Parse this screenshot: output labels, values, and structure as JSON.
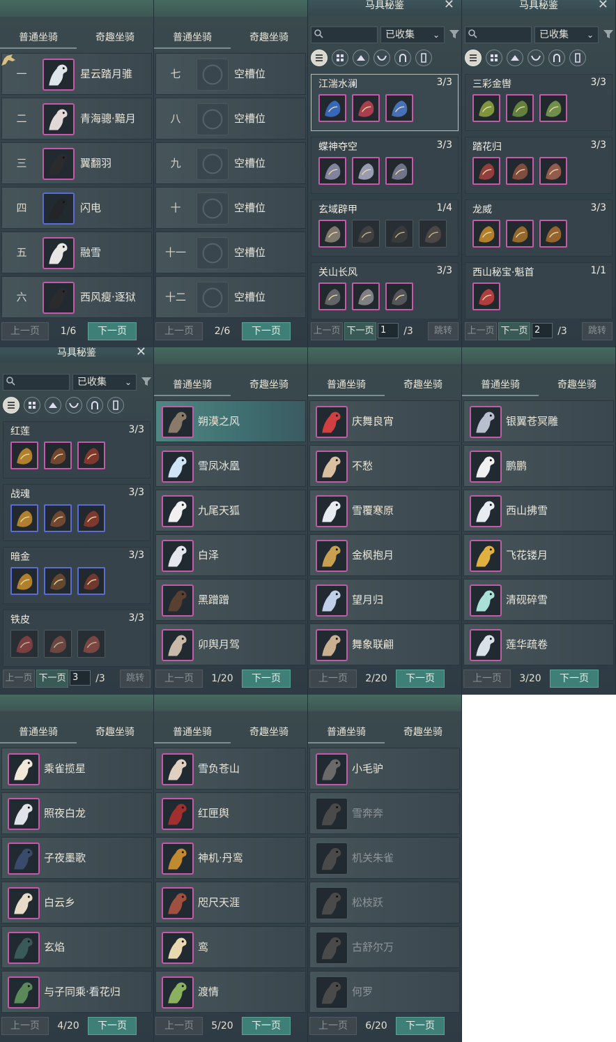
{
  "tab_labels": {
    "normal": "普通坐骑",
    "special": "奇趣坐骑"
  },
  "pager_labels": {
    "prev": "上一页",
    "next": "下一页",
    "jump": "跳转"
  },
  "codex": {
    "title": "马具秘鉴",
    "filter_value": "已收集",
    "search_placeholder": "",
    "close_glyph": "✕",
    "filter_chevron": "⌄"
  },
  "panels": [
    {
      "id": "slots-1",
      "page": "1/6",
      "rows": [
        {
          "num": "一",
          "name": "星云踏月骓",
          "frame": "pink",
          "color": "#dfe6ea"
        },
        {
          "num": "二",
          "name": "青海骢·黯月",
          "frame": "pink",
          "color": "#e2d8d6"
        },
        {
          "num": "三",
          "name": "翼翻羽",
          "frame": "pink",
          "color": "#2b2b2e"
        },
        {
          "num": "四",
          "name": "闪电",
          "frame": "blue",
          "color": "#242528"
        },
        {
          "num": "五",
          "name": "融雪",
          "frame": "pink",
          "color": "#e9e6e6"
        },
        {
          "num": "六",
          "name": "西风瘦·逐狱",
          "frame": "pink",
          "color": "#2b2b2e"
        }
      ]
    },
    {
      "id": "slots-2",
      "page": "2/6",
      "rows": [
        {
          "num": "七",
          "name": "空槽位",
          "frame": "none"
        },
        {
          "num": "八",
          "name": "空槽位",
          "frame": "none"
        },
        {
          "num": "九",
          "name": "空槽位",
          "frame": "none"
        },
        {
          "num": "十",
          "name": "空槽位",
          "frame": "none"
        },
        {
          "num": "十一",
          "name": "空槽位",
          "frame": "none"
        },
        {
          "num": "十二",
          "name": "空槽位",
          "frame": "none"
        }
      ]
    },
    {
      "id": "codex-1",
      "page_input": "1",
      "page_total": "/3",
      "sets": [
        {
          "name": "江湍水澜",
          "count": "3/3",
          "pieces": [
            "pink",
            "pink",
            "pink"
          ],
          "colors": [
            "#3a6ec8",
            "#b84050",
            "#4a78c8"
          ]
        },
        {
          "name": "蝶神夺空",
          "count": "3/3",
          "pieces": [
            "pink",
            "pink",
            "pink"
          ],
          "colors": [
            "#8c8ea8",
            "#a6a8c0",
            "#7a7c94"
          ]
        },
        {
          "name": "玄域辟甲",
          "count": "1/4",
          "pieces": [
            "pink",
            "dark",
            "dark",
            "dark"
          ],
          "colors": [
            "#8a8274",
            "#4a4440",
            "#3e3a36",
            "#5a4a46"
          ]
        },
        {
          "name": "关山长风",
          "count": "3/3",
          "pieces": [
            "pink",
            "pink",
            "pink"
          ],
          "colors": [
            "#6a6a6e",
            "#8a8a8e",
            "#5a5a5e"
          ]
        }
      ]
    },
    {
      "id": "codex-2",
      "page_input": "2",
      "page_total": "/3",
      "sets": [
        {
          "name": "三彩金辔",
          "count": "3/3",
          "pieces": [
            "pink",
            "pink",
            "pink"
          ],
          "colors": [
            "#8aa040",
            "#6a8a40",
            "#7a9a50"
          ]
        },
        {
          "name": "踏花归",
          "count": "3/3",
          "pieces": [
            "pink",
            "pink",
            "pink"
          ],
          "colors": [
            "#a04040",
            "#8a5040",
            "#a06050"
          ]
        },
        {
          "name": "龙威",
          "count": "3/3",
          "pieces": [
            "pink",
            "pink",
            "pink"
          ],
          "colors": [
            "#c08a30",
            "#a07030",
            "#a06a30"
          ]
        },
        {
          "name": "西山秘宝·魁首",
          "count": "1/1",
          "pieces": [
            "pink"
          ],
          "colors": [
            "#c04040"
          ]
        }
      ]
    },
    {
      "id": "codex-3",
      "page_input": "3",
      "page_total": "/3",
      "sets": [
        {
          "name": "红莲",
          "count": "3/3",
          "pieces": [
            "pink",
            "pink",
            "pink"
          ],
          "colors": [
            "#c08a30",
            "#7a4a30",
            "#8a3a30"
          ]
        },
        {
          "name": "战魂",
          "count": "3/3",
          "pieces": [
            "blue",
            "blue",
            "blue"
          ],
          "colors": [
            "#c08a30",
            "#7a4a30",
            "#8a3a30"
          ]
        },
        {
          "name": "暗金",
          "count": "3/3",
          "pieces": [
            "blue",
            "blue",
            "blue"
          ],
          "colors": [
            "#c08a30",
            "#6a4a30",
            "#7a3a30"
          ]
        },
        {
          "name": "铁皮",
          "count": "3/3",
          "pieces": [
            "dark",
            "dark",
            "dark"
          ],
          "colors": [
            "#a04040",
            "#8a4a40",
            "#a04a40"
          ]
        }
      ]
    },
    {
      "id": "special-1",
      "page": "1/20",
      "rows": [
        {
          "name": "朔漠之风",
          "frame": "pink",
          "color": "#8a7a6a",
          "selected": true
        },
        {
          "name": "雪凤冰凰",
          "frame": "pink",
          "color": "#cfe4f4"
        },
        {
          "name": "九尾天狐",
          "frame": "pink",
          "color": "#f0f0f0"
        },
        {
          "name": "白泽",
          "frame": "pink",
          "color": "#e4e8ee"
        },
        {
          "name": "黑蹭蹭",
          "frame": "pink",
          "color": "#5a4030"
        },
        {
          "name": "卯舆月驾",
          "frame": "pink",
          "color": "#c8b8a8"
        }
      ]
    },
    {
      "id": "special-2",
      "page": "2/20",
      "rows": [
        {
          "name": "庆舞良宵",
          "frame": "pink",
          "color": "#d04040"
        },
        {
          "name": "不愁",
          "frame": "pink",
          "color": "#d8c0a0"
        },
        {
          "name": "雪覆寒原",
          "frame": "pink",
          "color": "#e8ecf0"
        },
        {
          "name": "金枫抱月",
          "frame": "pink",
          "color": "#c8a050"
        },
        {
          "name": "望月归",
          "frame": "pink",
          "color": "#c0d0e8"
        },
        {
          "name": "舞象联翩",
          "frame": "pink",
          "color": "#c8b090"
        }
      ]
    },
    {
      "id": "special-3",
      "page": "3/20",
      "rows": [
        {
          "name": "银翼苍冥雕",
          "frame": "pink",
          "color": "#b8c0d0"
        },
        {
          "name": "鹏鹏",
          "frame": "pink",
          "color": "#f0f0f0"
        },
        {
          "name": "西山拂雪",
          "frame": "pink",
          "color": "#e8ecf0"
        },
        {
          "name": "飞花镂月",
          "frame": "pink",
          "color": "#e0b040"
        },
        {
          "name": "清砚碎雪",
          "frame": "pink",
          "color": "#a8e0d8"
        },
        {
          "name": "莲华疏卷",
          "frame": "pink",
          "color": "#d8e0e8"
        }
      ]
    },
    {
      "id": "special-4",
      "page": "4/20",
      "rows": [
        {
          "name": "乘雀揽星",
          "frame": "pink",
          "color": "#f0e8d8"
        },
        {
          "name": "照夜白龙",
          "frame": "pink",
          "color": "#e0e4e8"
        },
        {
          "name": "子夜墨歌",
          "frame": "pink",
          "color": "#3a4a6a"
        },
        {
          "name": "白云乡",
          "frame": "pink",
          "color": "#e8dcc8"
        },
        {
          "name": "玄焰",
          "frame": "pink",
          "color": "#3a5a5a"
        },
        {
          "name": "与子同乘·看花归",
          "frame": "pink",
          "color": "#5a8a5a"
        }
      ]
    },
    {
      "id": "special-5",
      "page": "5/20",
      "rows": [
        {
          "name": "雪负苍山",
          "frame": "pink",
          "color": "#e0d0c0"
        },
        {
          "name": "红匣舆",
          "frame": "pink",
          "color": "#a03030"
        },
        {
          "name": "神机·丹鸾",
          "frame": "pink",
          "color": "#c08a30"
        },
        {
          "name": "咫尺天涯",
          "frame": "pink",
          "color": "#a05040"
        },
        {
          "name": "鸾",
          "frame": "pink",
          "color": "#e8d8b0"
        },
        {
          "name": "渡情",
          "frame": "pink",
          "color": "#8ab060"
        }
      ]
    },
    {
      "id": "special-6",
      "page": "6/20",
      "rows": [
        {
          "name": "小毛驴",
          "frame": "pink",
          "color": "#6a6a6a",
          "dim": false
        },
        {
          "name": "雪奔奔",
          "frame": "none",
          "color": "#4a4a4a",
          "dim": true
        },
        {
          "name": "机关朱雀",
          "frame": "none",
          "color": "#4a4a4a",
          "dim": true
        },
        {
          "name": "松枝跃",
          "frame": "none",
          "color": "#4a4a4a",
          "dim": true
        },
        {
          "name": "古舒尔万",
          "frame": "none",
          "color": "#4a4a4a",
          "dim": true
        },
        {
          "name": "何罗",
          "frame": "none",
          "color": "#4a4a4a",
          "dim": true
        }
      ]
    }
  ],
  "colors": {
    "accent_teal": "#3e8078",
    "frame_pink": "#c55aa8",
    "frame_blue": "#5a6cd6"
  }
}
